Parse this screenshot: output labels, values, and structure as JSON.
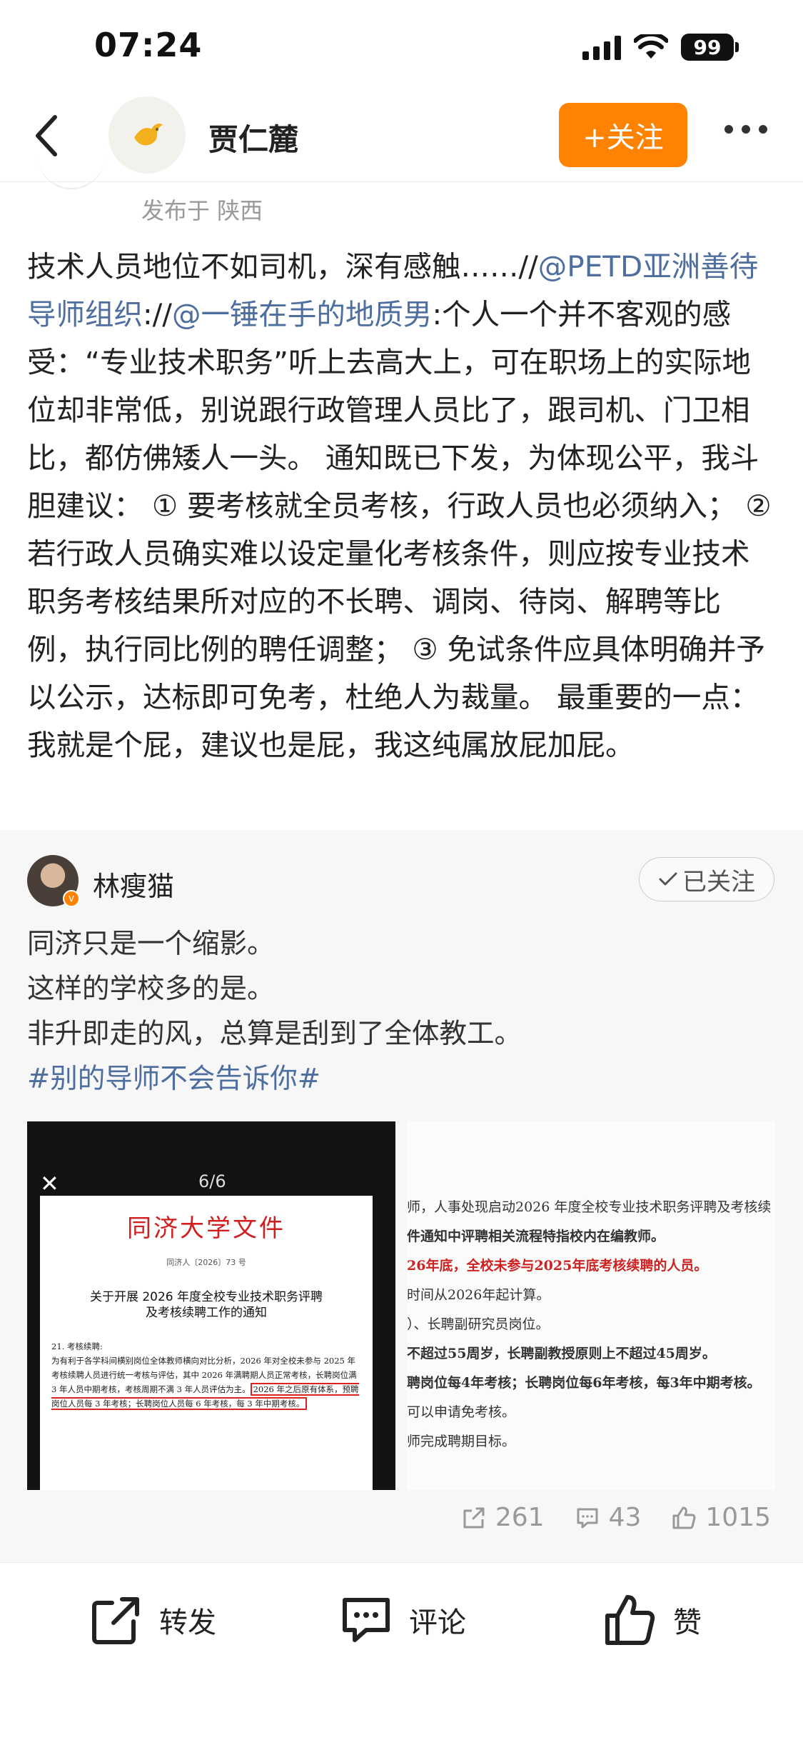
{
  "status_bar": {
    "time": "07:24",
    "battery": "99"
  },
  "nav": {
    "name": "贾仁麓",
    "follow_label": "+关注",
    "avatar_icon": "dove-logo-icon"
  },
  "published": "发布于 陕西",
  "post": {
    "t1": "技术人员地位不如司机，深有感触……//",
    "mention1": "@PETD亚洲善待导师组织",
    "t2": "://",
    "mention2": "@一锤在手的地质男",
    "t3": ":个人一个并不客观的感受：“专业技术职务”听上去高大上，可在职场上的实际地位却非常低，别说跟行政管理人员比了，跟司机、门卫相比，都仿佛矮人一头。 通知既已下发，为体现公平，我斗胆建议： ① 要考核就全员考核，行政人员也必须纳入； ② 若行政人员确实难以设定量化考核条件，则应按专业技术职务考核结果所对应的不长聘、调岗、待岗、解聘等比例，执行同比例的聘任调整； ③ 免试条件应具体明确并予以公示，达标即可免考，杜绝人为裁量。 最重要的一点：我就是个屁，建议也是屁，我这纯属放屁加屁。"
  },
  "repost": {
    "name": "林瘦猫",
    "followed_label": "已关注",
    "lines": [
      "同济只是一个缩影。",
      "这样的学校多的是。",
      "非升即走的风，总算是刮到了全体教工。"
    ],
    "hashtag": "#别的导师不会告诉你#",
    "image_left": {
      "counter": "6/6",
      "doc_title": "同济大学文件",
      "doc_number": "同济人〔2026〕73 号",
      "doc_heading_1": "关于开展 2026 年度全校专业技术职务评聘",
      "doc_heading_2": "及考核续聘工作的通知",
      "body_1": "21. 考核续聘:",
      "body_2": "为有利于各学科间横别岗位全体教师横向对比分析，2026 年对全校未参与 2025 年考核续聘人员进行统一考核与评估，其中 2026 年满聘期人员正常考核，长聘岗位满 3 年人员中期考核，考核周期不满 3 年人员评估为主。",
      "body_boxed": "2026 年之后原有体系，预聘岗位人员每 3 年考核；长聘岗位人员每 6 年考核，每 3 年中期考核。"
    },
    "image_right": {
      "lines": [
        "师，人事处现启动2026 年度全校专业技术职务评聘及考核续",
        "件通知中评聘相关流程特指校内在编教师。",
        "26年底，全校未参与2025年底考核续聘的人员。",
        "时间从2026年起计算。",
        "）、长聘副研究员岗位。",
        "不超过55周岁，长聘副教授原则上不超过45周岁。",
        "聘岗位每4年考核；长聘岗位每6年考核，每3年中期考核。",
        "可以申请免考核。",
        "师完成聘期目标。"
      ]
    },
    "stats": {
      "reposts": "261",
      "comments": "43",
      "likes": "1015"
    }
  },
  "bottom": {
    "repost_label": "转发",
    "comment_label": "评论",
    "like_label": "赞"
  }
}
